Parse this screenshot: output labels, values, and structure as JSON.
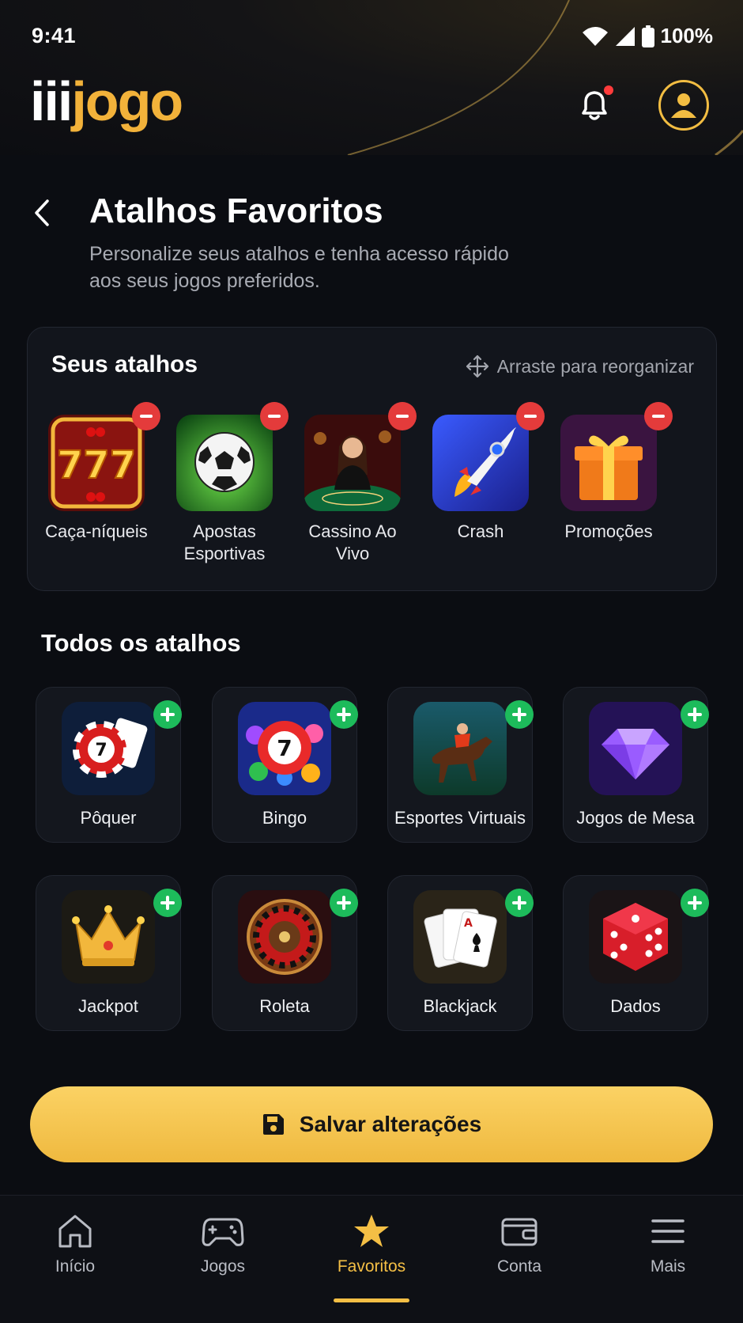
{
  "status_bar": {
    "time": "9:41",
    "battery": "100%"
  },
  "header": {
    "logo_prefix": "iii",
    "logo_suffix": "jogo",
    "logo_text": "iiijogo"
  },
  "page": {
    "title": "Atalhos Favoritos",
    "subtitle": "Personalize seus atalhos e tenha acesso rápido aos seus jogos preferidos."
  },
  "shortcuts": {
    "title": "Seus atalhos",
    "drag_hint": "Arraste para reorganizar",
    "items": [
      {
        "label": "Caça-níqueis",
        "icon": "slot-777-icon"
      },
      {
        "label": "Apostas Esportivas",
        "icon": "soccer-ball-icon"
      },
      {
        "label": "Cassino Ao Vivo",
        "icon": "live-dealer-icon"
      },
      {
        "label": "Crash",
        "icon": "rocket-icon"
      },
      {
        "label": "Promoções",
        "icon": "gift-box-icon"
      }
    ]
  },
  "all_shortcuts": {
    "title": "Todos os atalhos",
    "items": [
      {
        "label": "Pôquer",
        "icon": "poker-chip-icon"
      },
      {
        "label": "Bingo",
        "icon": "bingo-ball-icon"
      },
      {
        "label": "Esportes Virtuais",
        "icon": "horse-racing-icon"
      },
      {
        "label": "Jogos de Mesa",
        "icon": "diamond-icon"
      },
      {
        "label": "Jackpot",
        "icon": "crown-icon"
      },
      {
        "label": "Roleta",
        "icon": "roulette-icon"
      },
      {
        "label": "Blackjack",
        "icon": "playing-cards-icon"
      },
      {
        "label": "Dados",
        "icon": "dice-icon"
      }
    ]
  },
  "save_button": {
    "label": "Salvar alterações",
    "icon": "floppy-disk-icon"
  },
  "bottom_nav": {
    "items": [
      {
        "label": "Início",
        "icon": "home-icon"
      },
      {
        "label": "Jogos",
        "icon": "gamepad-icon"
      },
      {
        "label": "Favoritos",
        "icon": "star-icon"
      },
      {
        "label": "Conta",
        "icon": "wallet-icon"
      },
      {
        "label": "Mais",
        "icon": "menu-icon"
      }
    ],
    "active": "Favoritos"
  },
  "colors": {
    "accent": "#f4bf45",
    "remove": "#e43b3b",
    "add": "#1dbb5b",
    "background": "#0b0d12"
  }
}
